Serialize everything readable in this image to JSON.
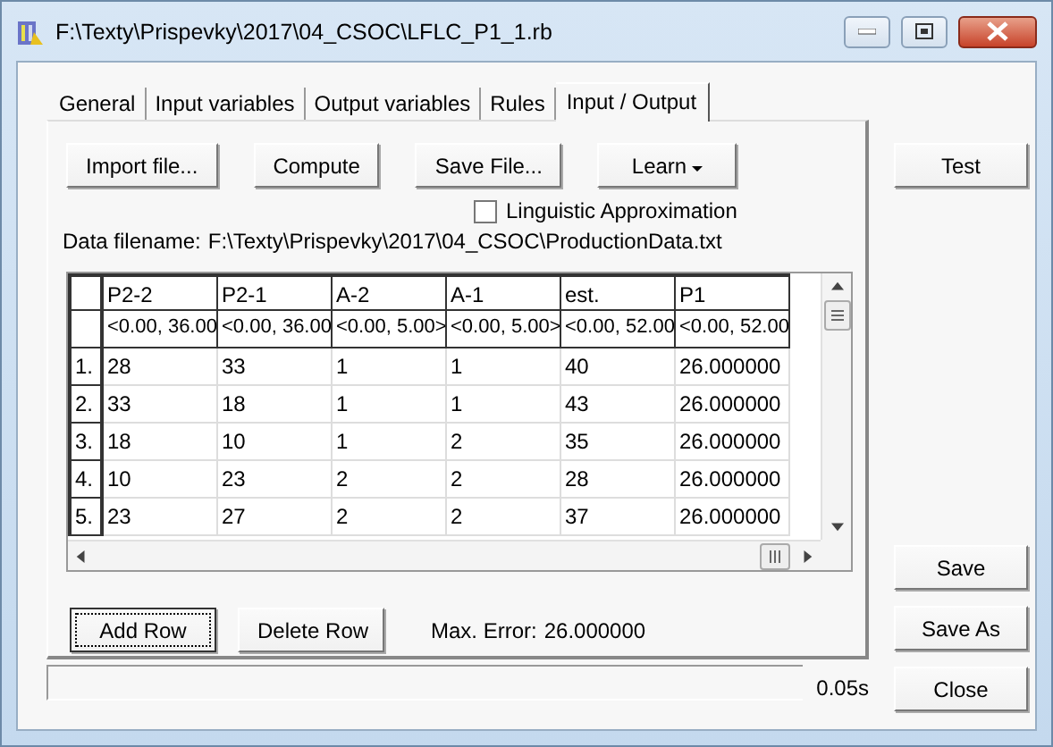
{
  "window": {
    "title": "F:\\Texty\\Prispevky\\2017\\04_CSOC\\LFLC_P1_1.rb"
  },
  "tabs": [
    {
      "label": "General",
      "selected": false
    },
    {
      "label": "Input variables",
      "selected": false
    },
    {
      "label": "Output variables",
      "selected": false
    },
    {
      "label": "Rules",
      "selected": false
    },
    {
      "label": "Input / Output",
      "selected": true
    }
  ],
  "toolbar_buttons": [
    "Import file...",
    "Compute",
    "Save File..."
  ],
  "learn_menu": {
    "label": "Learn"
  },
  "linguistic_approximation": {
    "label": "Linguistic Approximation",
    "checked": false
  },
  "data_filename": {
    "label": "Data filename:",
    "value": "F:\\Texty\\Prispevky\\2017\\04_CSOC\\ProductionData.txt"
  },
  "table": {
    "columns": [
      {
        "name": "P2-2",
        "range": "<0.00, 36.00"
      },
      {
        "name": "P2-1",
        "range": "<0.00, 36.00"
      },
      {
        "name": "A-2",
        "range": "<0.00, 5.00>"
      },
      {
        "name": "A-1",
        "range": "<0.00, 5.00>"
      },
      {
        "name": "est.",
        "range": "<0.00, 52.00"
      },
      {
        "name": "P1",
        "range": "<0.00, 52.00"
      }
    ],
    "rows": [
      {
        "number": "1.",
        "cells": [
          "28",
          "33",
          "1",
          "1",
          "40",
          "26.000000"
        ]
      },
      {
        "number": "2.",
        "cells": [
          "33",
          "18",
          "1",
          "1",
          "43",
          "26.000000"
        ]
      },
      {
        "number": "3.",
        "cells": [
          "18",
          "10",
          "1",
          "2",
          "35",
          "26.000000"
        ]
      },
      {
        "number": "4.",
        "cells": [
          "10",
          "23",
          "2",
          "2",
          "28",
          "26.000000"
        ]
      },
      {
        "number": "5.",
        "cells": [
          "23",
          "27",
          "2",
          "2",
          "37",
          "26.000000"
        ]
      }
    ]
  },
  "row_buttons": [
    {
      "label": "Add Row",
      "focused": true
    },
    {
      "label": "Delete Row",
      "focused": false
    }
  ],
  "max_error": {
    "label": "Max. Error:",
    "value": "26.000000"
  },
  "status_bar": {
    "elapsed": "0.05s"
  },
  "side_buttons_top": [
    "Test"
  ],
  "side_buttons_bottom": [
    "Save",
    "Save As",
    "Close"
  ]
}
